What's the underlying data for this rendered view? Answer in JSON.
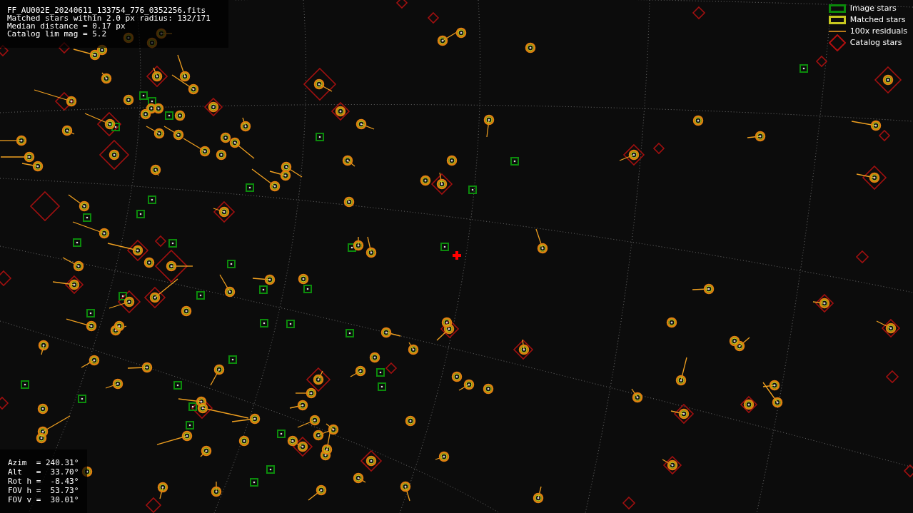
{
  "file_info": {
    "lines": [
      "FF_AU002E_20240611_133754_776_0352256.fits",
      "Matched stars within 2.0 px radius: 132/171",
      "Median distance = 0.17 px",
      "Catalog lim mag = 5.2"
    ]
  },
  "legend": [
    {
      "kind": "image",
      "label": "Image stars"
    },
    {
      "kind": "matched",
      "label": "Matched stars"
    },
    {
      "kind": "residual",
      "label": "100x residuals"
    },
    {
      "kind": "catalog",
      "label": "Catalog stars"
    }
  ],
  "pointing": {
    "lines": [
      "Azim  = 240.31°",
      "Alt   =  33.70°",
      "Rot h =  -8.43°",
      "FOV h =  53.73°",
      "FOV v =  30.01°"
    ]
  }
}
